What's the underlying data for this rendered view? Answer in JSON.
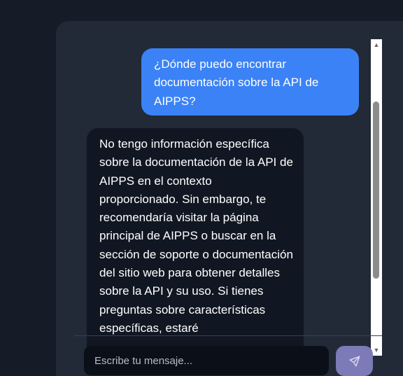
{
  "chat": {
    "messages": [
      {
        "role": "user",
        "text": "¿Dónde puedo encontrar documentación sobre la API de AIPPS?"
      },
      {
        "role": "assistant",
        "text": "No tengo información específica sobre la documentación de la API de AIPPS en el contexto proporcionado. Sin embargo, te recomendaría visitar la página principal de AIPPS o buscar en la sección de soporte o documentación del sitio web para obtener detalles sobre la API y su uso. Si tienes preguntas sobre características específicas, estaré"
      }
    ],
    "input": {
      "placeholder": "Escribe tu mensaje...",
      "value": ""
    }
  },
  "colors": {
    "page_background": "#161c27",
    "panel_background": "#222a37",
    "user_bubble": "#3b82f6",
    "assistant_bubble": "#111722",
    "send_button": "#7d7ab8"
  },
  "icons": {
    "send": "send-icon",
    "scroll_up": "scroll-up-arrow-icon",
    "scroll_down": "scroll-down-arrow-icon"
  }
}
